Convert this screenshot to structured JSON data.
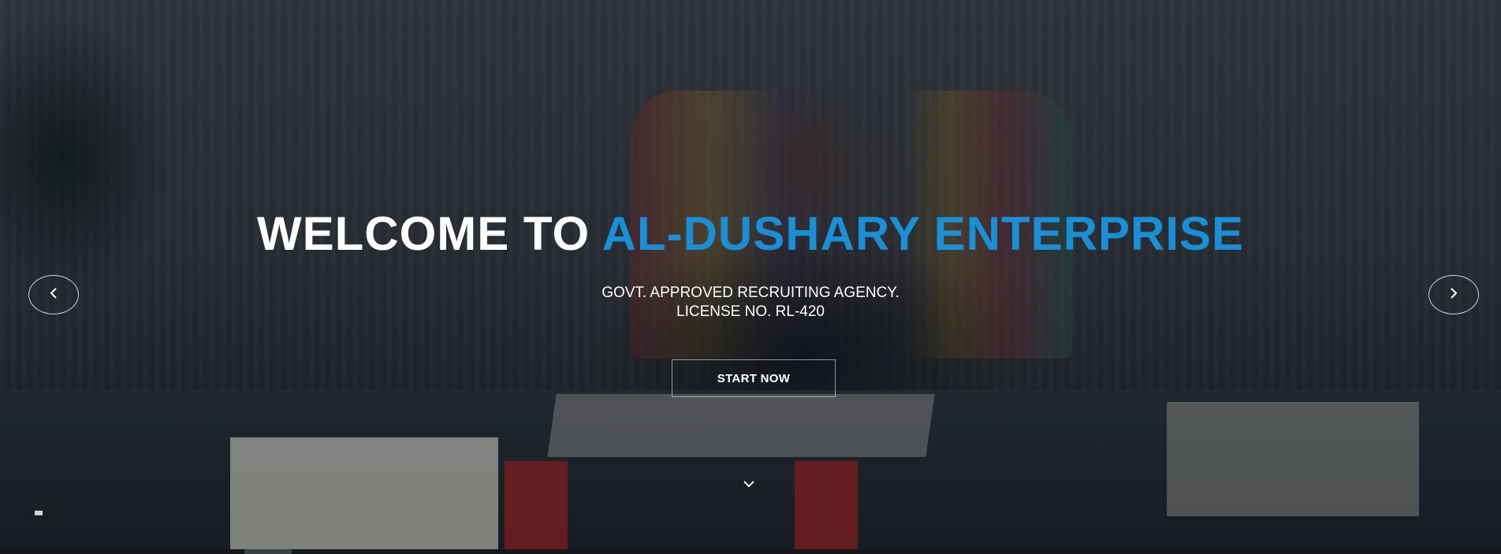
{
  "hero": {
    "headline_part1": "WELCOME TO",
    "headline_part2": "AL-DUSHARY ENTERPRISE",
    "subtitle_line1": "GOVT. APPROVED RECRUITING AGENCY.",
    "subtitle_line2": "LICENSE NO. RL-420",
    "cta_label": "START NOW"
  },
  "controls": {
    "prev_icon": "chevron-left-icon",
    "next_icon": "chevron-right-icon",
    "scroll_icon": "chevron-down-icon"
  },
  "colors": {
    "accent": "#1a8fd6",
    "headline_white": "#ffffff",
    "text": "#ffffff"
  }
}
